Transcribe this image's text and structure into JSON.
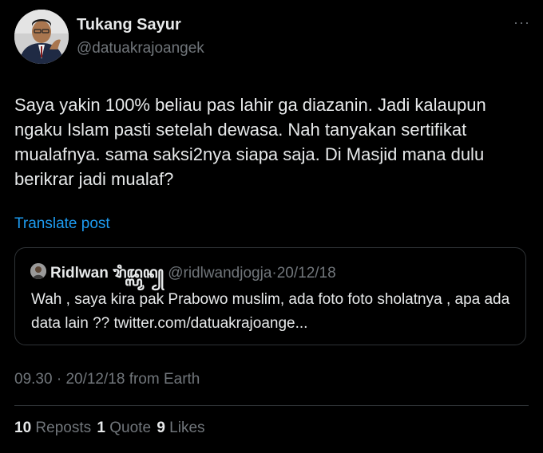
{
  "author": {
    "name": "Tukang Sayur",
    "handle": "@datuakrajoangek"
  },
  "post": {
    "text": "Saya yakin 100% beliau pas lahir ga diazanin. Jadi kalaupun ngaku Islam pasti setelah dewasa. Nah tanyakan sertifikat mualafnya. sama saksi2nya siapa saja. Di Masjid mana dulu berikrar jadi mualaf?",
    "translate_label": "Translate post",
    "more_icon": "···"
  },
  "quoted": {
    "name": "Ridlwan ꦫꦶꦢ꧀ꦭ꧀ꦮꦤ꧀",
    "handle": "@ridlwandjogja",
    "separator": "·",
    "date": "20/12/18",
    "text": "Wah , saya kira pak Prabowo muslim, ada foto foto sholatnya , apa ada data lain ?? twitter.com/datuakrajoange..."
  },
  "meta": {
    "time": "09.30",
    "separator": "·",
    "date": "20/12/18",
    "source": "from Earth"
  },
  "stats": {
    "reposts_count": "10",
    "reposts_label": "Reposts",
    "quotes_count": "1",
    "quotes_label": "Quote",
    "likes_count": "9",
    "likes_label": "Likes"
  },
  "colors": {
    "background": "#000000",
    "text": "#e7e9ea",
    "muted": "#71767b",
    "accent": "#1d9bf0",
    "border": "#2f3336"
  }
}
